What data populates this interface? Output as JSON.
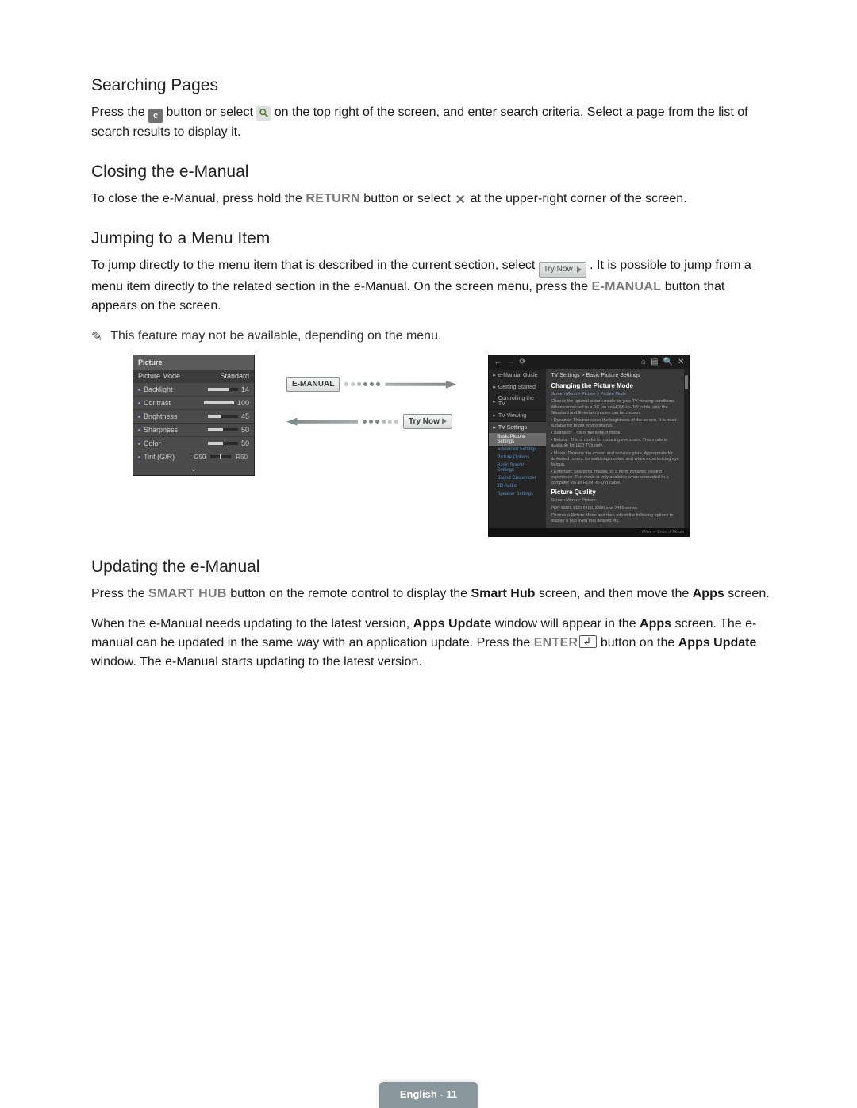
{
  "sections": {
    "searching": {
      "heading": "Searching Pages",
      "p1a": "Press the ",
      "c_icon_label": "c",
      "p1b": " button or select ",
      "p1c": " on the top right of the screen, and enter search criteria. Select a page from the list of search results to display it."
    },
    "closing": {
      "heading": "Closing the e-Manual",
      "p1a": "To close the e-Manual, press hold the ",
      "return": "RETURN",
      "p1b": " button or select ",
      "p1c": " at the upper-right corner of the screen."
    },
    "jumping": {
      "heading": "Jumping to a Menu Item",
      "p1a": "To jump directly to the menu item that is described in the current section, select ",
      "trynow": "Try Now",
      "p1b": ". It is possible to jump from a menu item directly to the related section in the e-Manual. On the screen menu, press the ",
      "emanual": "E-MANUAL",
      "p1c": " button that appears on the screen.",
      "note": "This feature may not be available, depending on the menu."
    },
    "updating": {
      "heading": "Updating the e-Manual",
      "p1a": "Press the ",
      "smarthub": "SMART HUB",
      "p1b": " button on the remote control to display the ",
      "smarthub2": "Smart Hub",
      "p1c": " screen, and then move the ",
      "apps": "Apps",
      "p1d": " screen.",
      "p2a": "When the e-Manual needs updating to the latest version, ",
      "appsupdate": "Apps Update",
      "p2b": " window will appear in the ",
      "p2c": " screen. The e-manual can be updated in the same way with an application update. Press the ",
      "enter": "ENTER",
      "p2d": " button on the ",
      "p2e": " window. The e-Manual starts updating to the latest version."
    }
  },
  "figure": {
    "osd": {
      "title": "Picture",
      "mode_label": "Picture Mode",
      "mode_value": "Standard",
      "rows": [
        {
          "name": "Backlight",
          "val": "14",
          "pct": 70
        },
        {
          "name": "Contrast",
          "val": "100",
          "pct": 100
        },
        {
          "name": "Brightness",
          "val": "45",
          "pct": 45
        },
        {
          "name": "Sharpness",
          "val": "50",
          "pct": 50
        },
        {
          "name": "Color",
          "val": "50",
          "pct": 50
        }
      ],
      "tint_name": "Tint (G/R)",
      "tint_g": "G50",
      "tint_r": "R50"
    },
    "buttons": {
      "emanual": "E-MANUAL",
      "trynow": "Try Now"
    },
    "emanual_panel": {
      "breadcrumb": "TV Settings > Basic Picture Settings",
      "h1": "Changing the Picture Mode",
      "path": "Screen Menu > Picture > Picture Mode",
      "quality_h": "Picture Quality",
      "nav": [
        {
          "label": "e-Manual Guide"
        },
        {
          "label": "Getting Started"
        },
        {
          "label": "Controlling the TV"
        },
        {
          "label": "TV Viewing"
        },
        {
          "label": "TV Settings",
          "selected": true,
          "subs": [
            {
              "label": "Basic Picture Settings",
              "selected": true
            },
            {
              "label": "Advanced Settings"
            },
            {
              "label": "Picture Options"
            },
            {
              "label": "Basic Sound Settings"
            },
            {
              "label": "Sound Customizer"
            },
            {
              "label": "3D Audio"
            },
            {
              "label": "Speaker Settings"
            }
          ]
        }
      ],
      "desc_lines": [
        "Choose the optimal picture mode for your TV viewing conditions. When connected to a PC via an HDMI-to-DVI cable, only the Standard and Entertain modes can be chosen.",
        "• Dynamic: This increases the brightness of the screen. It is most suitable for bright environments.",
        "• Standard: This is the default mode.",
        "• Natural: This is useful for reducing eye strain. This mode is available for LED TVs only.",
        "• Movie: Darkens the screen and reduces glare. Appropriate for darkened rooms, for watching movies, and when experiencing eye fatigue.",
        "• Entertain: Sharpens images for a more dynamic viewing experience. This mode is only available when connected to a computer via an HDMI-to-DVI cable."
      ],
      "quality_lines": [
        "Screen Menu > Picture",
        "PDP 5500, LED 6400, 6300 and 7450 series",
        "Choose a Picture Mode and then adjust the following options to display a hub even that desired etc."
      ],
      "footer": "↑ Move    ↵ Enter    ↺ Return"
    }
  },
  "footer": {
    "lang": "English",
    "page": "11"
  }
}
